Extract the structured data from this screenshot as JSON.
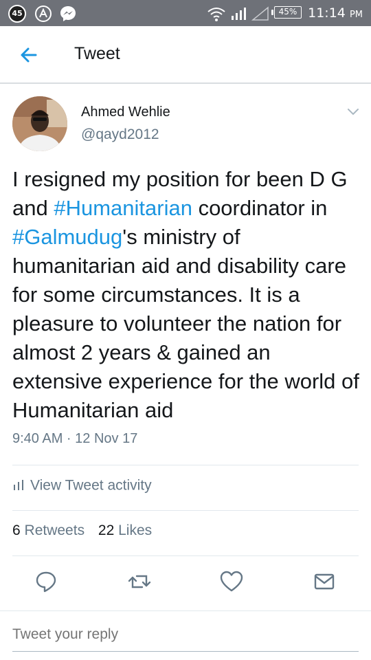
{
  "status_bar": {
    "notification_count": "45",
    "battery": "45%",
    "time": "11:14",
    "time_suffix": "PM"
  },
  "app_bar": {
    "title": "Tweet"
  },
  "tweet": {
    "author_name": "Ahmed Wehlie",
    "author_handle": "@qayd2012",
    "text_parts": {
      "p1": "I resigned my position for been D G and ",
      "hashtag1": "#Humanitarian",
      "p2": " coordinator in ",
      "hashtag2": "#Galmudug",
      "p3": "'s ministry of humanitarian aid and disability care for some circumstances. It is a pleasure to volunteer the nation for almost 2 years & gained an extensive experience for the world of Humanitarian aid"
    },
    "timestamp": "9:40 AM · 12 Nov 17",
    "activity_label": "View Tweet activity",
    "retweets_count": "6",
    "retweets_label": "Retweets",
    "likes_count": "22",
    "likes_label": "Likes"
  },
  "reply": {
    "placeholder": "Tweet your reply"
  },
  "colors": {
    "accent": "#1b95e0",
    "status_bar": "#6e7178",
    "secondary_text": "#657786"
  }
}
